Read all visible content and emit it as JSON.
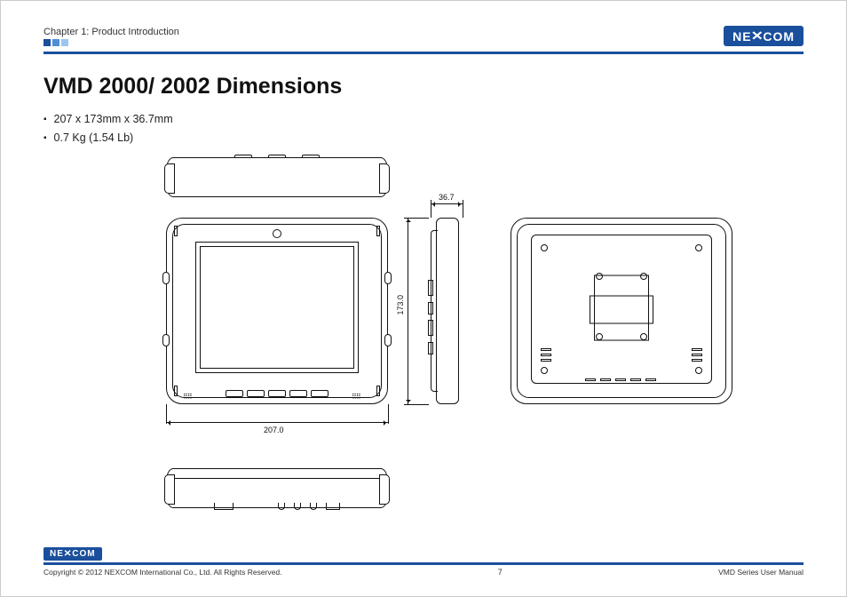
{
  "header": {
    "chapter": "Chapter 1: Product Introduction",
    "brand": "NEXCOM"
  },
  "title": "VMD 2000/ 2002 Dimensions",
  "specs": [
    "207 x 173mm x 36.7mm",
    "0.7 Kg (1.54 Lb)"
  ],
  "dimensions": {
    "width_mm": "207.0",
    "height_mm": "173.0",
    "depth_mm": "36.7"
  },
  "footer": {
    "brand": "NEXCOM",
    "copyright": "Copyright © 2012 NEXCOM International Co., Ltd. All Rights Reserved.",
    "page": "7",
    "manual": "VMD Series User Manual"
  }
}
